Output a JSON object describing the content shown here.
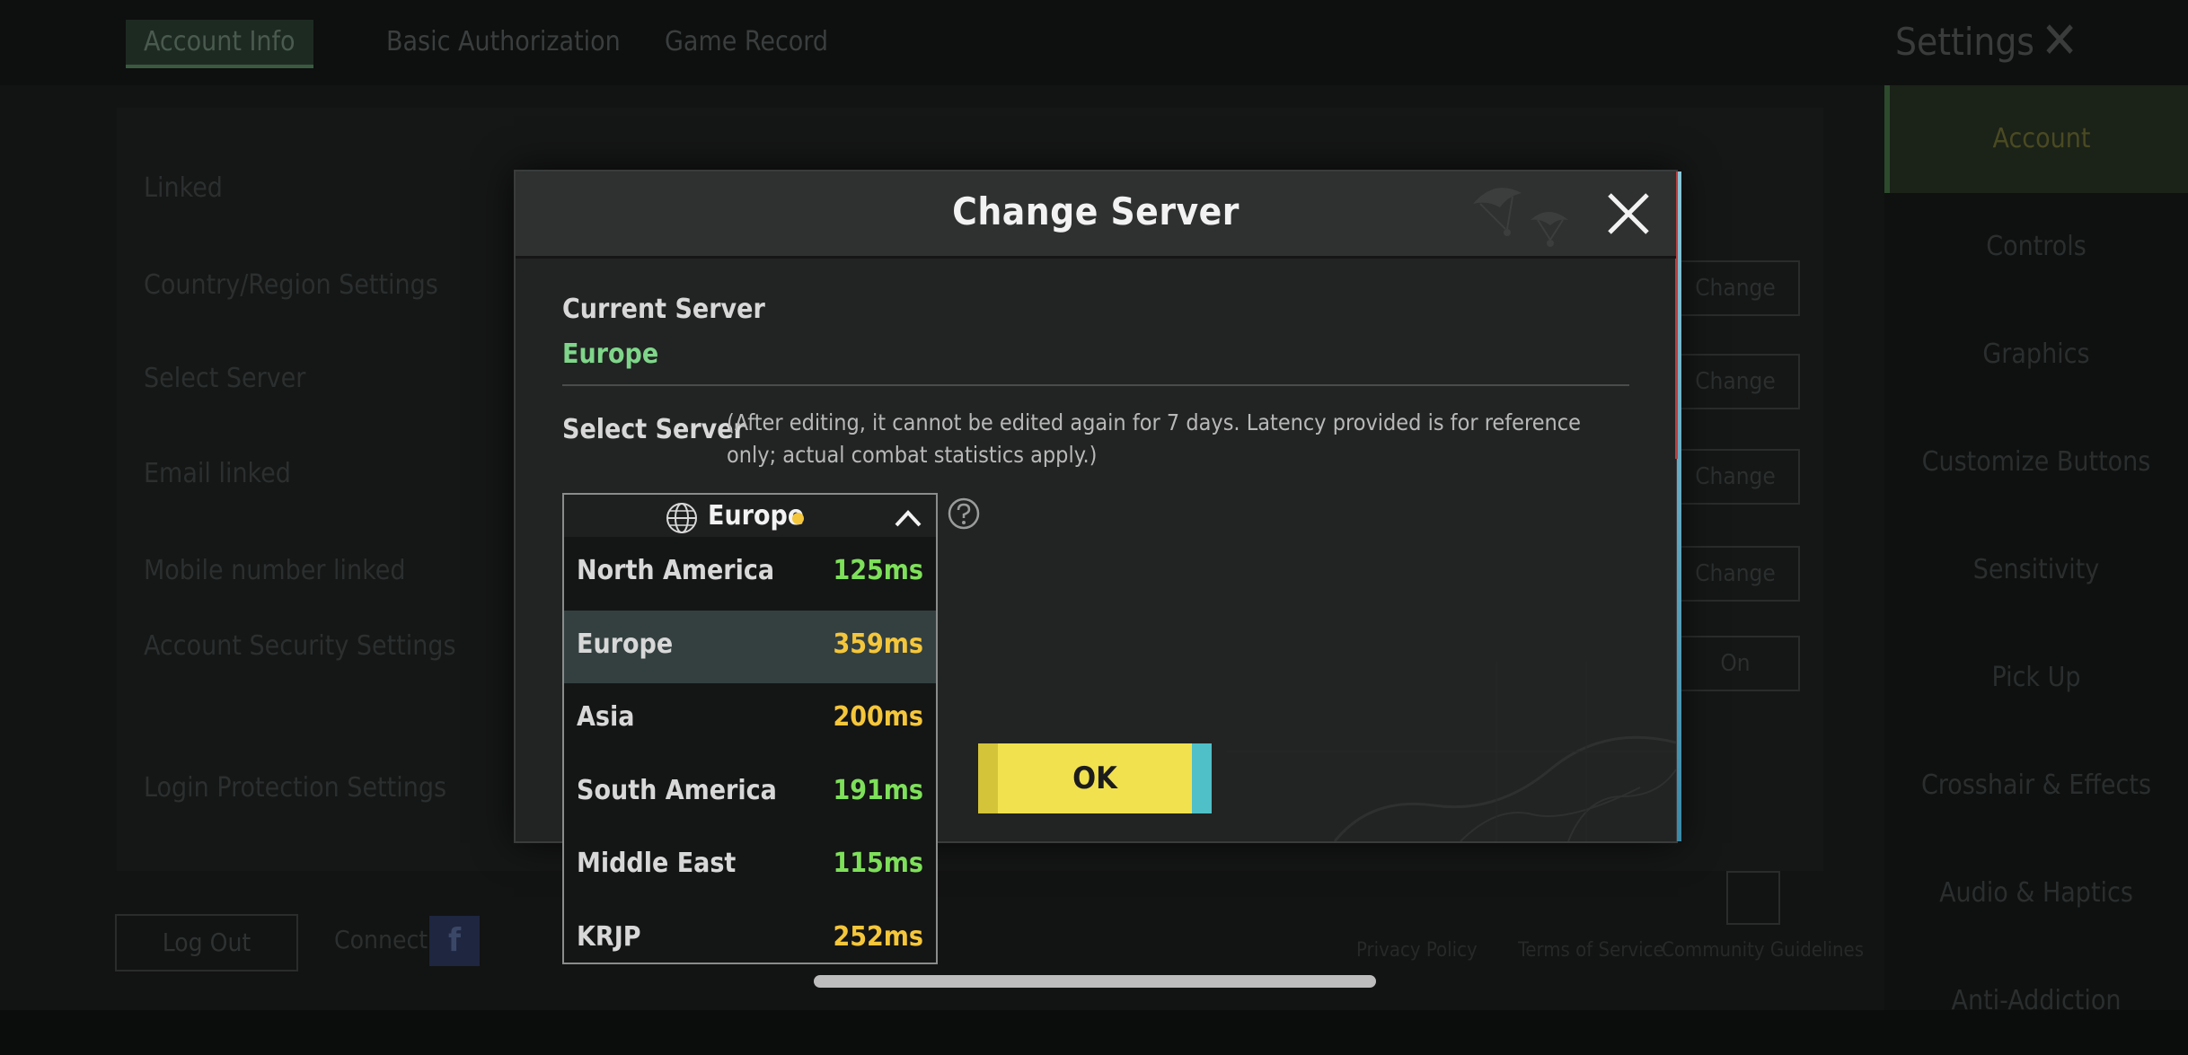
{
  "background": {
    "tabs": [
      "Account Info",
      "Basic Authorization",
      "Game Record"
    ],
    "settings_title": "Settings",
    "rows": [
      "Linked",
      "Country/Region Settings",
      "Select Server",
      "Email linked",
      "Mobile number linked",
      "Account Security Settings",
      "Login Protection Settings"
    ],
    "row_buttons": [
      "Change",
      "Change",
      "Change",
      "Change",
      "On"
    ],
    "sidebar": [
      "Account",
      "Controls",
      "Graphics",
      "Customize Buttons",
      "Sensitivity",
      "Pick Up",
      "Crosshair & Effects",
      "Audio & Haptics",
      "Anti-Addiction"
    ],
    "log_out": "Log Out",
    "connect": "Connect",
    "footer_links": [
      "Privacy Policy",
      "Terms of Service",
      "Community Guidelines"
    ]
  },
  "modal": {
    "title": "Change Server",
    "current_label": "Current Server",
    "current_value": "Europe",
    "select_label": "Select Server",
    "note": "(After editing, it cannot be edited again for 7 days. Latency provided is for reference only; actual combat statistics apply.)",
    "dropdown_value": "Europe",
    "ok_label": "OK"
  },
  "servers": [
    {
      "name": "North America",
      "latency": "125ms",
      "color": "#7ee05a",
      "selected": false
    },
    {
      "name": "Europe",
      "latency": "359ms",
      "color": "#f4c63b",
      "selected": true
    },
    {
      "name": "Asia",
      "latency": "200ms",
      "color": "#f4c63b",
      "selected": false
    },
    {
      "name": "South America",
      "latency": "191ms",
      "color": "#7ee05a",
      "selected": false
    },
    {
      "name": "Middle East",
      "latency": "115ms",
      "color": "#7ee05a",
      "selected": false
    },
    {
      "name": "KRJP",
      "latency": "252ms",
      "color": "#f4c63b",
      "selected": false
    }
  ],
  "colors": {
    "current_server": "#7fd68a",
    "ok_button": "#f1e14f",
    "status_dot": "#f4c63b"
  }
}
